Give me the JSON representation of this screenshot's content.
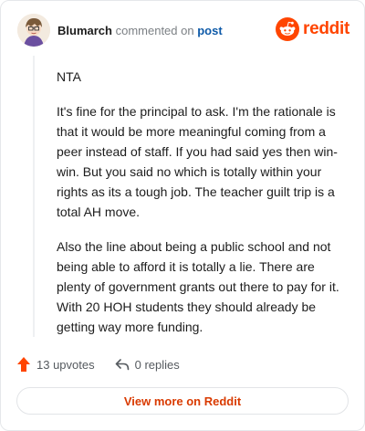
{
  "header": {
    "username": "Blumarch",
    "action_text": "commented on",
    "post_link": "post",
    "brand": "reddit"
  },
  "comment": {
    "paragraphs": [
      "NTA",
      "It's fine for the principal to ask. I'm the rationale is that it would be more meaningful coming from a peer instead of staff. If you had said yes then win-win. But you said no which is totally within your rights as its a tough job. The teacher guilt trip is a total AH move.",
      "Also the line about being a public school and not being able to afford it is totally a lie. There are plenty of government grants out there to pay for it. With 20 HOH students they should already be getting way more funding."
    ]
  },
  "actions": {
    "upvotes": "13 upvotes",
    "replies": "0 replies"
  },
  "footer": {
    "view_more": "View more on Reddit"
  },
  "colors": {
    "brand": "#ff4500",
    "link": "#0e5aa8",
    "view_more_text": "#d93a00"
  },
  "icons": [
    "avatar",
    "reddit-logo-icon",
    "upvote-arrow-icon",
    "reply-icon"
  ]
}
